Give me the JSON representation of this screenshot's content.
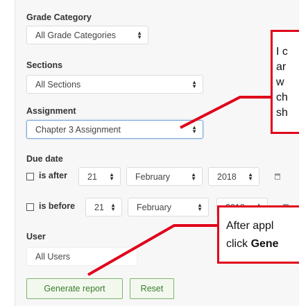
{
  "grade_category": {
    "label": "Grade Category",
    "value": "All Grade Categories"
  },
  "sections": {
    "label": "Sections",
    "value": "All Sections"
  },
  "assignment": {
    "label": "Assignment",
    "value": "Chapter 3 Assignment"
  },
  "due_date": {
    "label": "Due date",
    "after": {
      "label": "is after",
      "day": "21",
      "month": "February",
      "year": "2018"
    },
    "before": {
      "label": "is before",
      "day": "21",
      "month": "February",
      "year": "2018"
    }
  },
  "user": {
    "label": "User",
    "value": "All Users"
  },
  "buttons": {
    "generate": "Generate report",
    "reset": "Reset"
  },
  "callout_top": {
    "lines": [
      "I c",
      "ar",
      "w",
      "ch",
      "sh"
    ]
  },
  "callout_bottom": {
    "line1": "After appl",
    "line2_prefix": "click ",
    "line2_bold": "Gene"
  },
  "colors": {
    "annotation_red": "#e0001a",
    "button_green": "#3a7d2a",
    "focus_blue": "#7aa7d8"
  }
}
